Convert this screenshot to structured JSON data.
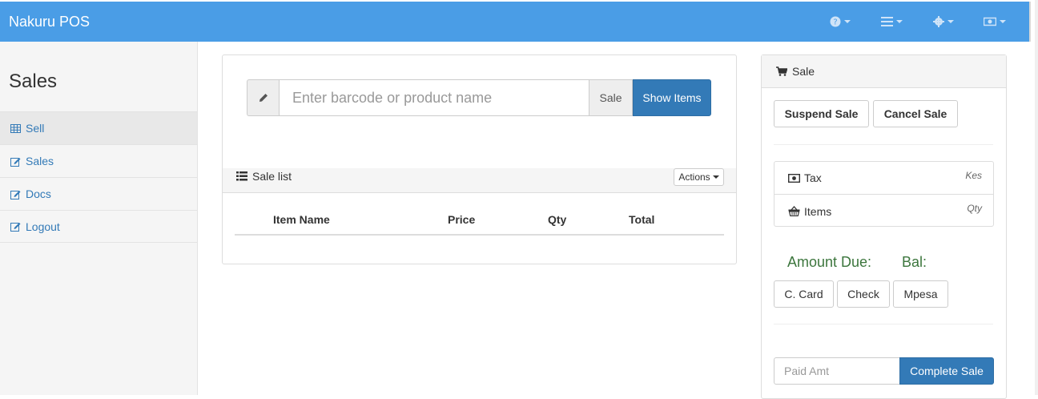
{
  "navbar": {
    "brand": "Nakuru POS",
    "icons": [
      "help-icon",
      "list-icon",
      "gear-icon",
      "cash-icon"
    ]
  },
  "sidebar": {
    "title": "Sales",
    "items": [
      {
        "label": "Sell",
        "icon": "table-icon"
      },
      {
        "label": "Sales",
        "icon": "edit-icon"
      },
      {
        "label": "Docs",
        "icon": "edit-icon"
      },
      {
        "label": "Logout",
        "icon": "edit-icon"
      }
    ]
  },
  "search": {
    "placeholder": "Enter barcode or product name",
    "sale_label": "Sale",
    "show_items_label": "Show Items"
  },
  "sale_list": {
    "title": "Sale list",
    "actions_label": "Actions",
    "columns": [
      "Item Name",
      "Price",
      "Qty",
      "Total"
    ]
  },
  "sale_panel": {
    "title": "Sale",
    "suspend_label": "Suspend Sale",
    "cancel_label": "Cancel Sale",
    "tax_label": "Tax",
    "tax_value": "Kes",
    "items_label": "Items",
    "items_value": "Qty",
    "amount_due_label": "Amount Due:",
    "bal_label": "Bal:",
    "payment_methods": [
      "C. Card",
      "Check",
      "Mpesa"
    ],
    "paid_placeholder": "Paid Amt",
    "complete_label": "Complete Sale"
  },
  "colors": {
    "navbar": "#4a9de6",
    "primary": "#337ab7",
    "success_text": "#3c763d"
  }
}
